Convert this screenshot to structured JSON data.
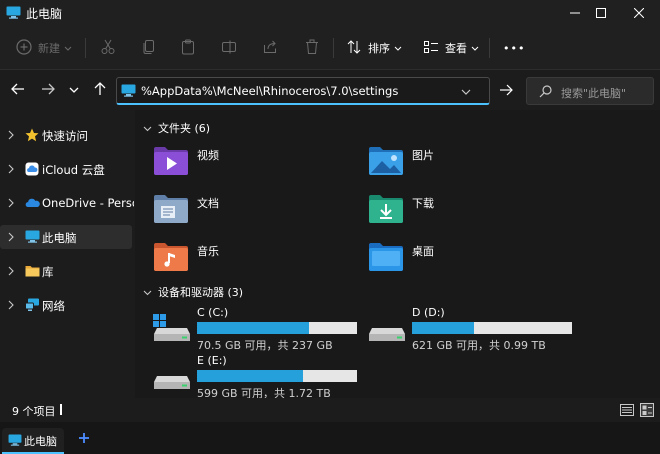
{
  "window": {
    "title": "此电脑"
  },
  "commandbar": {
    "new_label": "新建",
    "sort_label": "排序",
    "view_label": "查看",
    "more_label": "•••"
  },
  "nav": {
    "address": "%AppData%\\McNeel\\Rhinoceros\\7.0\\settings",
    "search_placeholder": "搜索\"此电脑\""
  },
  "sidebar": {
    "items": [
      {
        "label": "快速访问",
        "icon": "star-icon"
      },
      {
        "label": "iCloud 云盘",
        "icon": "icloud-icon"
      },
      {
        "label": "OneDrive - Personal",
        "icon": "onedrive-icon"
      },
      {
        "label": "此电脑",
        "icon": "this-pc-icon"
      },
      {
        "label": "库",
        "icon": "library-icon"
      },
      {
        "label": "网络",
        "icon": "network-icon"
      }
    ]
  },
  "main": {
    "folders_header": "文件夹 (6)",
    "folders": [
      {
        "name": "视频",
        "icon": "videos-folder-icon"
      },
      {
        "name": "图片",
        "icon": "pictures-folder-icon"
      },
      {
        "name": "文档",
        "icon": "documents-folder-icon"
      },
      {
        "name": "下载",
        "icon": "downloads-folder-icon"
      },
      {
        "name": "音乐",
        "icon": "music-folder-icon"
      },
      {
        "name": "桌面",
        "icon": "desktop-folder-icon"
      }
    ],
    "drives_header": "设备和驱动器 (3)",
    "drives": [
      {
        "name": "C (C:)",
        "info": "70.5 GB 可用，共 237 GB",
        "used_fraction": 0.7
      },
      {
        "name": "D (D:)",
        "info": "621 GB 可用，共 0.99 TB",
        "used_fraction": 0.39
      },
      {
        "name": "E (E:)",
        "info": "599 GB 可用，共 1.72 TB",
        "used_fraction": 0.66
      }
    ]
  },
  "status": {
    "item_count": "9 个项目"
  },
  "tabs": [
    {
      "label": "此电脑"
    }
  ],
  "colors": {
    "accent": "#4cc2ff",
    "drive_bar": "#26a0da"
  }
}
